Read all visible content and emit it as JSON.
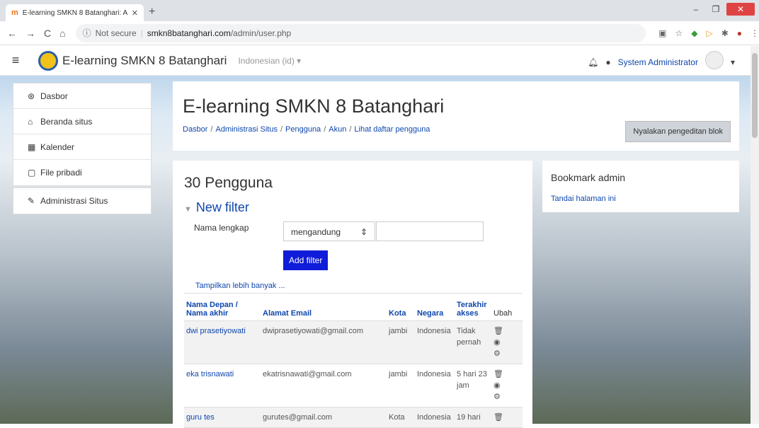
{
  "browser": {
    "tab_title": "E-learning SMKN 8 Batanghari: A",
    "security": "Not secure",
    "url_host": "smkn8batanghari.com",
    "url_path": "/admin/user.php"
  },
  "navbar": {
    "site_name": "E-learning SMKN 8 Batanghari",
    "language": "Indonesian (id) ▾",
    "user_name": "System Administrator"
  },
  "sidebar": {
    "items": [
      {
        "label": "Dasbor",
        "icon": "dashboard-icon"
      },
      {
        "label": "Beranda situs",
        "icon": "home-icon"
      },
      {
        "label": "Kalender",
        "icon": "calendar-icon"
      },
      {
        "label": "File pribadi",
        "icon": "file-icon"
      }
    ],
    "admin": {
      "label": "Administrasi Situs",
      "icon": "wrench-icon"
    }
  },
  "header": {
    "title": "E-learning SMKN 8 Batanghari",
    "breadcrumb": [
      "Dasbor",
      "Administrasi Situs",
      "Pengguna",
      "Akun",
      "Lihat daftar pengguna"
    ],
    "edit_button": "Nyalakan pengeditan blok"
  },
  "main": {
    "count_title": "30 Pengguna",
    "filter_title": "New filter",
    "filter_label": "Nama lengkap",
    "filter_operator": "mengandung",
    "add_filter": "Add filter",
    "show_more": "Tampilkan lebih banyak ...",
    "table": {
      "headers": {
        "name": "Nama Depan / Nama akhir",
        "email": "Alamat Email",
        "city": "Kota",
        "country": "Negara",
        "last": "Terakhir akses",
        "edit": "Ubah"
      },
      "rows": [
        {
          "name": "dwi prasetiyowati",
          "email": "dwiprasetiyowati@gmail.com",
          "city": "jambi",
          "country": "Indonesia",
          "last": "Tidak pernah"
        },
        {
          "name": "eka trisnawati",
          "email": "ekatrisnawati@gmail.com",
          "city": "jambi",
          "country": "Indonesia",
          "last": "5 hari 23 jam"
        },
        {
          "name": "guru tes",
          "email": "gurutes@gmail.com",
          "city": "Kota",
          "country": "Indonesia",
          "last": "19 hari"
        }
      ]
    }
  },
  "bookmarks": {
    "title": "Bookmark admin",
    "link": "Tandai halaman ini"
  }
}
